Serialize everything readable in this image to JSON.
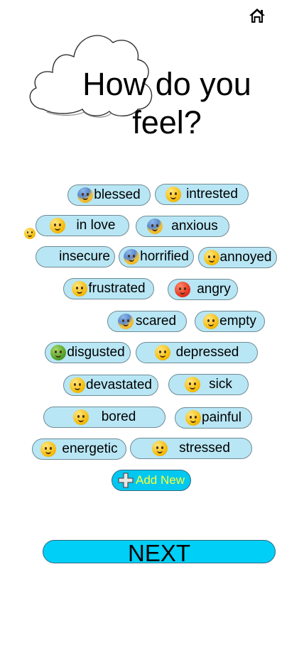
{
  "header": {
    "home_icon": "home-icon",
    "title": "How do you feel?"
  },
  "feelings": [
    {
      "label": "blessed",
      "icon": "smiling-face-with-halo-icon"
    },
    {
      "label": "intrested",
      "icon": "face-with-monocle-icon"
    },
    {
      "label": "in love",
      "icon": "smiling-face-with-hearts-icon"
    },
    {
      "label": "anxious",
      "icon": "anxious-face-with-sweat-icon"
    },
    {
      "label": "insecure",
      "icon": ""
    },
    {
      "label": "horrified",
      "icon": "face-screaming-in-fear-icon"
    },
    {
      "label": "annoyed",
      "icon": "face-with-rolling-eyes-icon"
    },
    {
      "label": "frustrated",
      "icon": "face-with-steam-from-nose-icon"
    },
    {
      "label": "angry",
      "icon": "angry-face-icon"
    },
    {
      "label": "scared",
      "icon": "fearful-face-icon"
    },
    {
      "label": "empty",
      "icon": "face-with-open-mouth-icon"
    },
    {
      "label": "disgusted",
      "icon": "nauseated-face-icon"
    },
    {
      "label": "depressed",
      "icon": "pensive-face-icon"
    },
    {
      "label": "devastated",
      "icon": "crying-face-icon"
    },
    {
      "label": "sick",
      "icon": "face-with-thermometer-icon"
    },
    {
      "label": "bored",
      "icon": "yawning-face-icon"
    },
    {
      "label": "painful",
      "icon": "face-with-head-bandage-icon"
    },
    {
      "label": "energetic",
      "icon": "smiling-face-with-raised-hands-icon"
    },
    {
      "label": "stressed",
      "icon": "grimacing-face-icon"
    }
  ],
  "stray_icon": "confused-face-icon",
  "add_new": {
    "label": "Add New",
    "icon": "plus-icon",
    "text_color": "#ffff33",
    "bg_color": "#00c8f0"
  },
  "next_button": {
    "label": "NEXT",
    "bg_color": "#00cff7"
  },
  "colors": {
    "chip_bg": "#b8e6f4",
    "chip_border": "#6f8a94"
  }
}
